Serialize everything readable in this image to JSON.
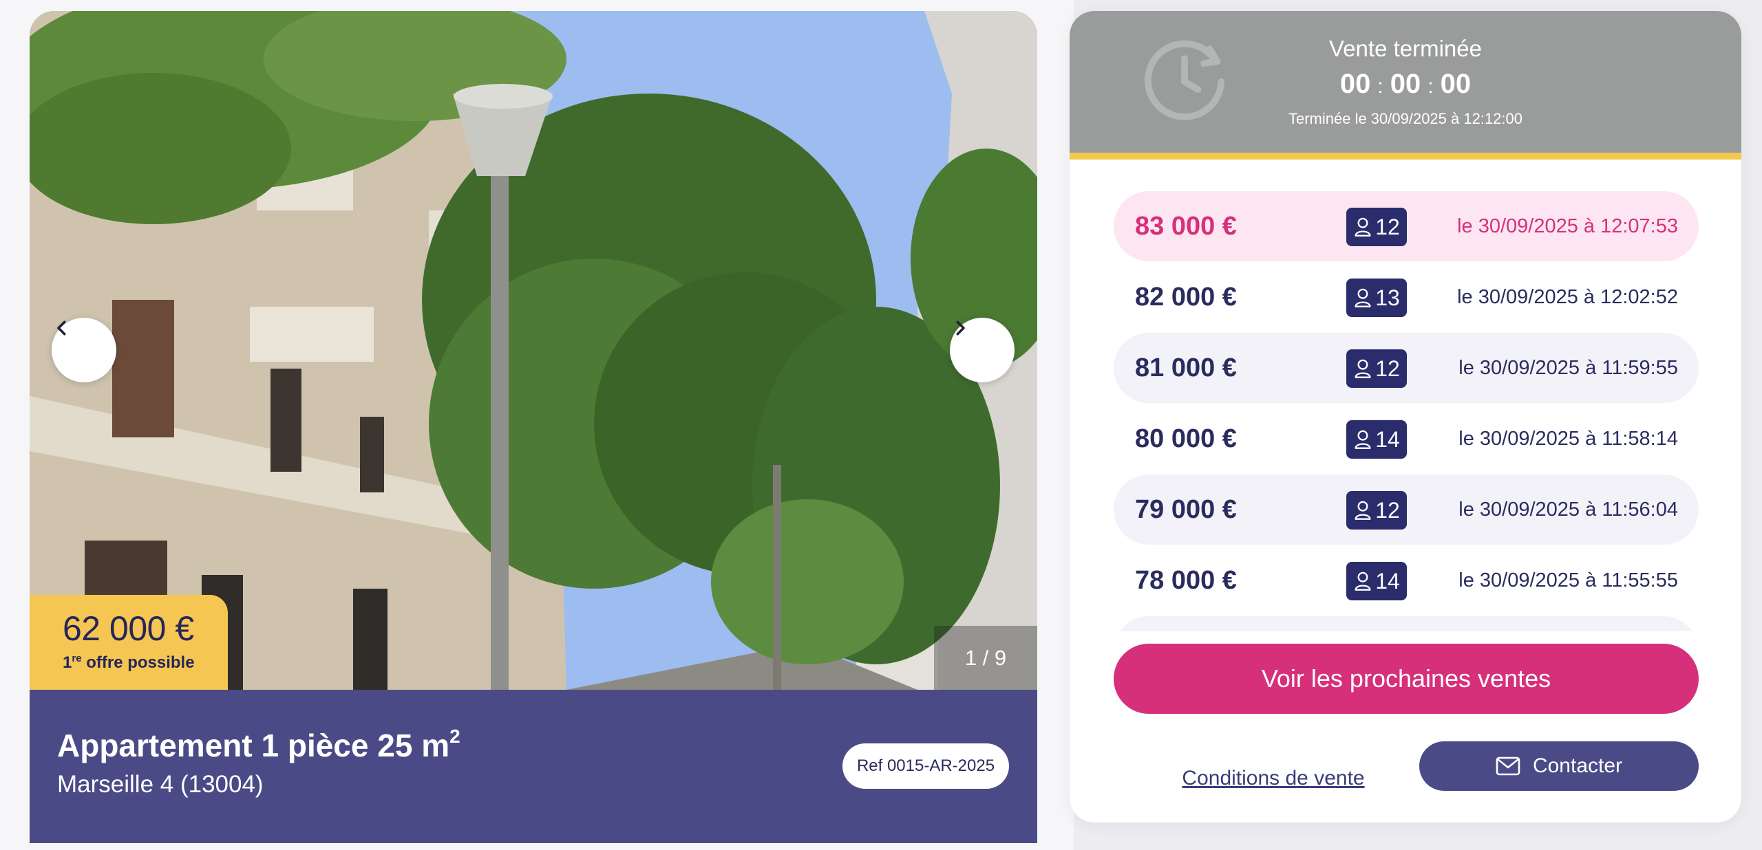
{
  "gallery": {
    "counter": "1 / 9",
    "prev_icon": "chevron-left-icon",
    "next_icon": "chevron-right-icon"
  },
  "price_tag": {
    "amount": "62 000 €",
    "sub_prefix": "1",
    "sub_sup": "re",
    "sub_suffix": " offre possible"
  },
  "listing": {
    "title_main": "Appartement 1 pièce 25 m",
    "title_sup": "2",
    "city": "Marseille 4 (13004)",
    "ref": "Ref 0015-AR-2025"
  },
  "status": {
    "title": "Vente terminée",
    "hours": "00",
    "minutes": "00",
    "seconds": "00",
    "sep": ":",
    "ended_at": "Terminée le 30/09/2025 à 12:12:00",
    "icon": "clock-history-icon"
  },
  "bids": [
    {
      "amount": "83 000 €",
      "bidder": "12",
      "date": "le 30/09/2025 à 12:07:53"
    },
    {
      "amount": "82 000 €",
      "bidder": "13",
      "date": "le 30/09/2025 à 12:02:52"
    },
    {
      "amount": "81 000 €",
      "bidder": "12",
      "date": "le 30/09/2025 à 11:59:55"
    },
    {
      "amount": "80 000 €",
      "bidder": "14",
      "date": "le 30/09/2025 à 11:58:14"
    },
    {
      "amount": "79 000 €",
      "bidder": "12",
      "date": "le 30/09/2025 à 11:56:04"
    },
    {
      "amount": "78 000 €",
      "bidder": "14",
      "date": "le 30/09/2025 à 11:55:55"
    }
  ],
  "actions": {
    "cta": "Voir les prochaines ventes",
    "conditions": "Conditions de vente",
    "contact": "Contacter"
  },
  "colors": {
    "brand_navy": "#4a4b86",
    "brand_pink": "#d6307b",
    "accent_yellow": "#f2c94c",
    "ended_grey": "#9a9b9b"
  }
}
